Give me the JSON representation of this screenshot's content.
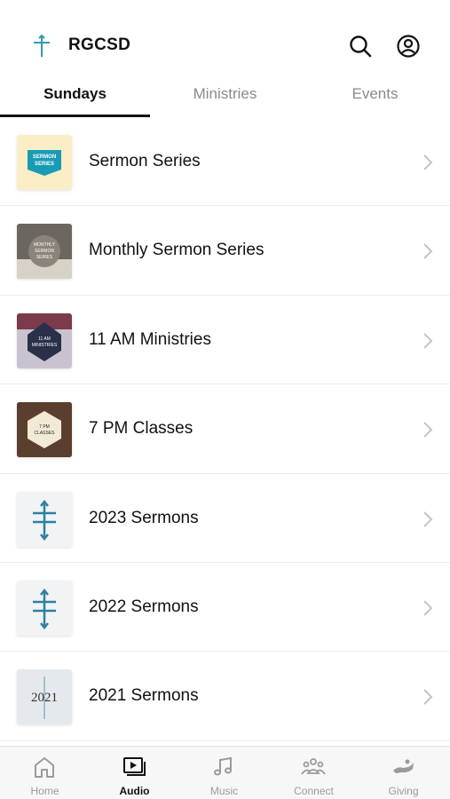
{
  "app": {
    "title": "RGCSD"
  },
  "tabs": [
    {
      "label": "Sundays",
      "active": true
    },
    {
      "label": "Ministries",
      "active": false
    },
    {
      "label": "Events",
      "active": false
    }
  ],
  "list": [
    {
      "label": "Sermon Series",
      "thumb_text": "SERMON SERIES"
    },
    {
      "label": "Monthly Sermon Series",
      "thumb_text": "MONTHLY SERMON SERIES"
    },
    {
      "label": "11 AM Ministries",
      "thumb_text": "11 AM MINISTRIES"
    },
    {
      "label": "7 PM Classes",
      "thumb_text": "7 PM CLASSES"
    },
    {
      "label": "2023 Sermons"
    },
    {
      "label": "2022 Sermons"
    },
    {
      "label": "2021 Sermons",
      "thumb_text": "2021"
    }
  ],
  "nav": [
    {
      "label": "Home",
      "icon": "home-icon"
    },
    {
      "label": "Audio",
      "icon": "audio-play-icon",
      "active": true
    },
    {
      "label": "Music",
      "icon": "music-note-icon"
    },
    {
      "label": "Connect",
      "icon": "people-icon"
    },
    {
      "label": "Giving",
      "icon": "giving-hand-icon"
    }
  ],
  "colors": {
    "brand": "#2e7fa0",
    "accent_teal": "#1a9bb5",
    "text": "#111111",
    "muted": "#8a8a8a"
  }
}
